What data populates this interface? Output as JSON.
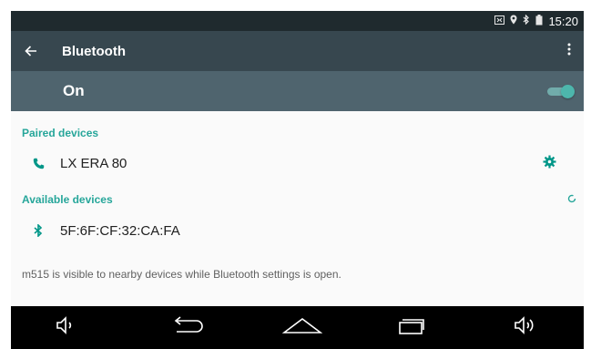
{
  "status_bar": {
    "icons": [
      "nfc-icon",
      "location-icon",
      "bluetooth-icon",
      "battery-icon"
    ],
    "time": "15:20"
  },
  "app_bar": {
    "title": "Bluetooth",
    "back_icon": "arrow-left-icon",
    "overflow_icon": "more-vert-icon"
  },
  "toggle_bar": {
    "label": "On",
    "state": true
  },
  "paired": {
    "header": "Paired devices",
    "devices": [
      {
        "name": "LX ERA 80",
        "icon": "phone-icon",
        "action_icon": "gear-icon"
      }
    ]
  },
  "available": {
    "header": "Available devices",
    "spinner_icon": "refresh-spinner-icon",
    "devices": [
      {
        "name": "5F:6F:CF:32:CA:FA",
        "icon": "bluetooth-icon"
      }
    ]
  },
  "note": "m515 is visible to nearby devices while Bluetooth settings is open.",
  "nav_bar": {
    "buttons": [
      "volume-down-icon",
      "back-icon",
      "home-icon",
      "recents-icon",
      "volume-up-icon"
    ]
  },
  "colors": {
    "accent": "#009688",
    "appbar": "#37474f",
    "onbar": "#4f646e",
    "statusbar": "#1f2a2e"
  }
}
